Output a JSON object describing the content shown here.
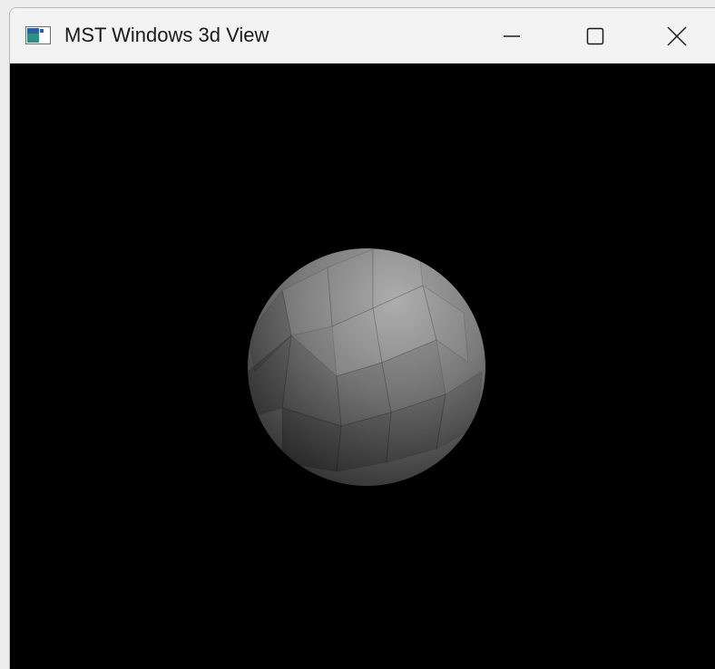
{
  "window": {
    "title": "MST Windows 3d View",
    "icon": "app-window-icon",
    "controls": {
      "minimize_icon": "minimize-icon",
      "maximize_icon": "maximize-icon",
      "close_icon": "close-icon"
    }
  },
  "viewport": {
    "background_color": "#000000",
    "object": "faceted-sphere",
    "shade_light": "#a6a6a6",
    "shade_mid": "#7a7a7a",
    "shade_dark": "#2e2e2e"
  }
}
